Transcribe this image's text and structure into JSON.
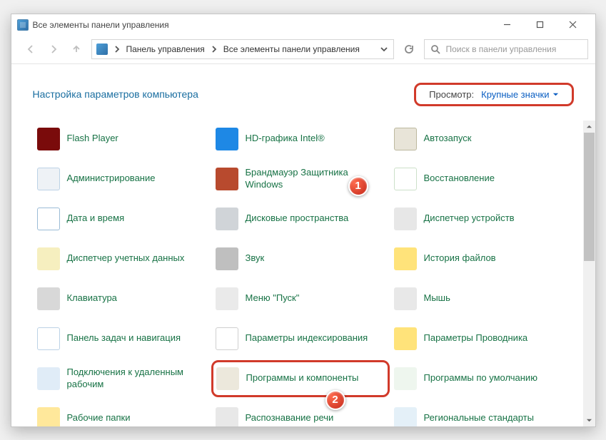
{
  "window": {
    "title": "Все элементы панели управления"
  },
  "nav": {
    "breadcrumb": [
      "Панель управления",
      "Все элементы панели управления"
    ]
  },
  "search": {
    "placeholder": "Поиск в панели управления"
  },
  "header": {
    "title": "Настройка параметров компьютера",
    "view_label": "Просмотр:",
    "view_value": "Крупные значки"
  },
  "items": [
    {
      "label": "Flash Player",
      "icon": "ic-flash"
    },
    {
      "label": "HD-графика Intel®",
      "icon": "ic-intel"
    },
    {
      "label": "Автозапуск",
      "icon": "ic-autorun"
    },
    {
      "label": "Администрирование",
      "icon": "ic-admin"
    },
    {
      "label": "Брандмауэр Защитника Windows",
      "icon": "ic-firewall"
    },
    {
      "label": "Восстановление",
      "icon": "ic-recovery"
    },
    {
      "label": "Дата и время",
      "icon": "ic-date"
    },
    {
      "label": "Дисковые пространства",
      "icon": "ic-disk"
    },
    {
      "label": "Диспетчер устройств",
      "icon": "ic-devmgr"
    },
    {
      "label": "Диспетчер учетных данных",
      "icon": "ic-accdata"
    },
    {
      "label": "Звук",
      "icon": "ic-sound"
    },
    {
      "label": "История файлов",
      "icon": "ic-filehist"
    },
    {
      "label": "Клавиатура",
      "icon": "ic-keyboard"
    },
    {
      "label": "Меню \"Пуск\"",
      "icon": "ic-start"
    },
    {
      "label": "Мышь",
      "icon": "ic-mouse"
    },
    {
      "label": "Панель задач и навигация",
      "icon": "ic-taskbar"
    },
    {
      "label": "Параметры индексирования",
      "icon": "ic-index"
    },
    {
      "label": "Параметры Проводника",
      "icon": "ic-explopt"
    },
    {
      "label": "Подключения к удаленным рабочим",
      "icon": "ic-remote"
    },
    {
      "label": "Программы и компоненты",
      "icon": "ic-programs",
      "highlight": true
    },
    {
      "label": "Программы по умолчанию",
      "icon": "ic-default"
    },
    {
      "label": "Рабочие папки",
      "icon": "ic-workf"
    },
    {
      "label": "Распознавание речи",
      "icon": "ic-speech"
    },
    {
      "label": "Региональные стандарты",
      "icon": "ic-region"
    }
  ],
  "annotations": {
    "badge1": "1",
    "badge2": "2"
  }
}
